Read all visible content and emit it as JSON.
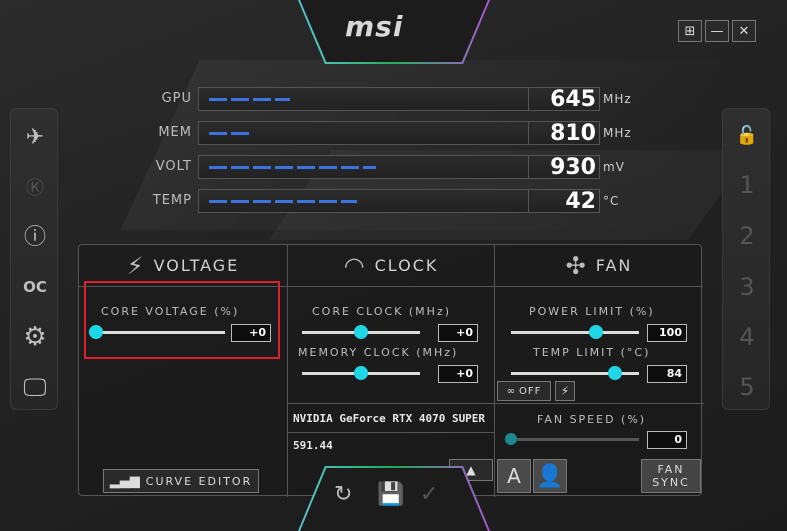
{
  "app": {
    "logo": "msi"
  },
  "window_buttons": [
    {
      "name": "windows-icon",
      "glyph": "⊞"
    },
    {
      "name": "minimize-icon",
      "glyph": "—"
    },
    {
      "name": "close-icon",
      "glyph": "✕"
    }
  ],
  "left_sidebar": [
    {
      "name": "afterburner-icon",
      "glyph": "✈"
    },
    {
      "name": "kombustor-icon",
      "glyph": "Ⓚ"
    },
    {
      "name": "info-icon",
      "glyph": "ⓘ"
    },
    {
      "name": "oc-scanner-icon",
      "glyph": "OC"
    },
    {
      "name": "settings-icon",
      "glyph": "⚙"
    },
    {
      "name": "monitor-icon",
      "glyph": "🖵"
    }
  ],
  "right_sidebar": {
    "lock_glyph": "🔓",
    "profiles": [
      "1",
      "2",
      "3",
      "4",
      "5"
    ]
  },
  "monitors": [
    {
      "label": "GPU",
      "value": "645",
      "unit": "MHz",
      "fill": 0.22
    },
    {
      "label": "MEM",
      "value": "810",
      "unit": "MHz",
      "fill": 0.12
    },
    {
      "label": "VOLT",
      "value": "930",
      "unit": "mV",
      "fill": 0.45
    },
    {
      "label": "TEMP",
      "value": "42",
      "unit": "°C",
      "fill": 0.4
    }
  ],
  "voltage": {
    "title": "VOLTAGE",
    "core_voltage_label": "CORE VOLTAGE  (%)",
    "core_voltage_value": "+0",
    "core_voltage_level": 0.0,
    "curve_editor_label": "CURVE EDITOR"
  },
  "clock": {
    "title": "CLOCK",
    "core_clock_label": "CORE CLOCK (MHz)",
    "core_clock_value": "+0",
    "core_clock_level": 0.5,
    "memory_clock_label": "MEMORY CLOCK (MHz)",
    "memory_clock_value": "+0",
    "memory_clock_level": 0.5,
    "gpu_name": "NVIDIA GeForce RTX 4070 SUPER",
    "driver_version": "591.44"
  },
  "fan": {
    "title": "FAN",
    "power_limit_label": "POWER LIMIT (%)",
    "power_limit_value": "100",
    "power_limit_level": 0.68,
    "temp_limit_label": "TEMP LIMIT (°C)",
    "temp_limit_value": "84",
    "temp_limit_level": 0.85,
    "link_off_label": "OFF",
    "fan_speed_label": "FAN SPEED (%)",
    "fan_speed_value": "0",
    "fan_speed_level": 0.0,
    "auto_label": "A",
    "fan_sync_line1": "FAN",
    "fan_sync_line2": "SYNC"
  },
  "colors": {
    "accent": "#1fd6e6",
    "highlight": "#e0202a",
    "bar_fill": "#3b74e0"
  }
}
